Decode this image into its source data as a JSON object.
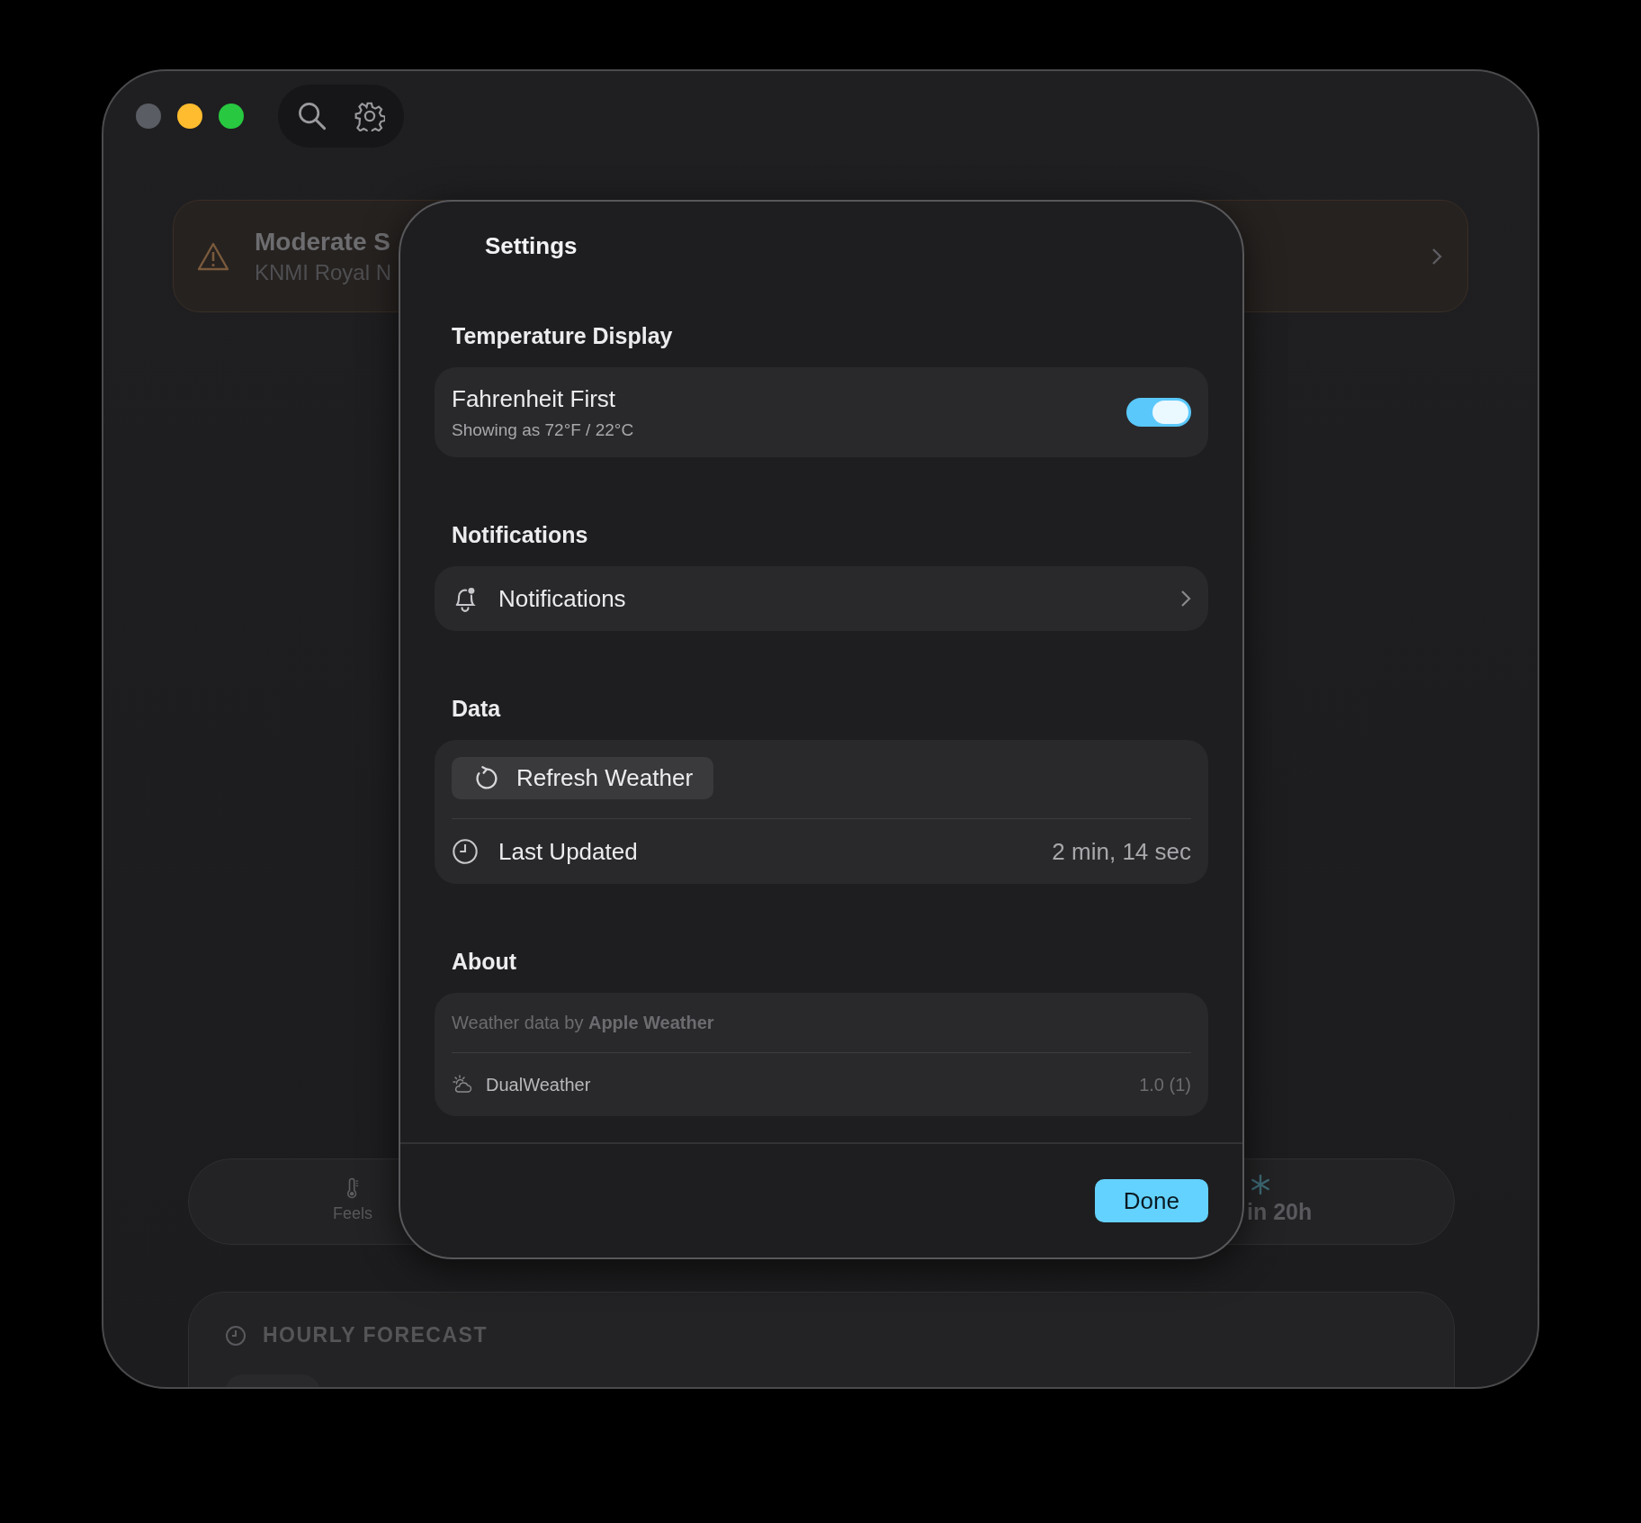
{
  "window": {
    "controls": [
      {
        "kind": "close",
        "disabled": true
      },
      {
        "kind": "minimize",
        "disabled": false
      },
      {
        "kind": "zoom",
        "disabled": false
      }
    ]
  },
  "alert": {
    "title": "Moderate S",
    "source": "KNMI Royal N"
  },
  "stats": {
    "feels": "Feels",
    "snow": "in 20h"
  },
  "hourly": {
    "title": "HOURLY FORECAST"
  },
  "settings": {
    "title": "Settings",
    "temperature": {
      "heading": "Temperature Display",
      "label": "Fahrenheit First",
      "detail": "Showing as 72°F / 22°C",
      "on": true
    },
    "notifications": {
      "heading": "Notifications",
      "label": "Notifications"
    },
    "data": {
      "heading": "Data",
      "refresh": "Refresh Weather",
      "last_label": "Last Updated",
      "last_value": "2 min, 14 sec"
    },
    "about": {
      "heading": "About",
      "credit": "Weather data by **Apple Weather**",
      "app": "DualWeather",
      "version": "1.0 (1)"
    },
    "done": "Done"
  }
}
